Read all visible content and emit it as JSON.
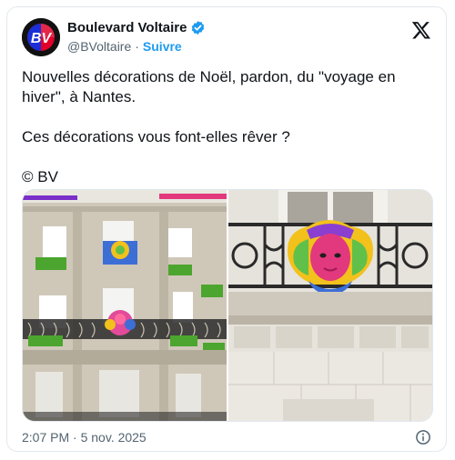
{
  "account": {
    "display_name": "Boulevard Voltaire",
    "handle": "@BVoltaire",
    "separator": "·",
    "follow_label": "Suivre",
    "avatar_text": "BV",
    "verified_color": "#1d9bf0"
  },
  "tweet": {
    "paragraphs": [
      "Nouvelles décorations de Noël, pardon, du \"voyage en hiver\", à Nantes.",
      "Ces décorations vous font-elles rêver ?",
      "© BV"
    ],
    "timestamp": "2:07 PM · 5 nov. 2025"
  },
  "media": {
    "images": [
      {
        "icon": "photo-building-facade"
      },
      {
        "icon": "photo-balcony-sculpture"
      }
    ]
  },
  "icons": {
    "platform": "x-logo-icon",
    "verified": "verified-badge-icon",
    "info": "info-icon"
  }
}
